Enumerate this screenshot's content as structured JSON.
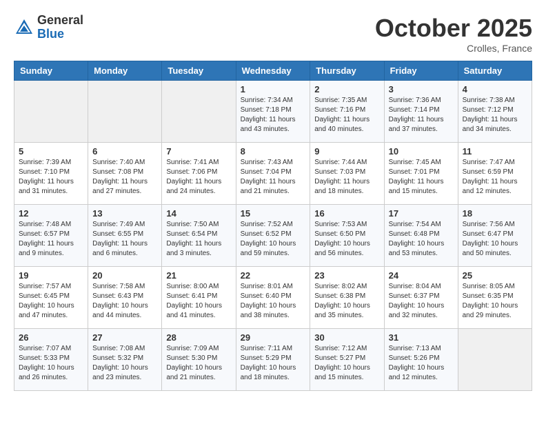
{
  "header": {
    "logo_line1": "General",
    "logo_line2": "Blue",
    "month_title": "October 2025",
    "location": "Crolles, France"
  },
  "days_of_week": [
    "Sunday",
    "Monday",
    "Tuesday",
    "Wednesday",
    "Thursday",
    "Friday",
    "Saturday"
  ],
  "weeks": [
    [
      {
        "day": "",
        "info": ""
      },
      {
        "day": "",
        "info": ""
      },
      {
        "day": "",
        "info": ""
      },
      {
        "day": "1",
        "info": "Sunrise: 7:34 AM\nSunset: 7:18 PM\nDaylight: 11 hours\nand 43 minutes."
      },
      {
        "day": "2",
        "info": "Sunrise: 7:35 AM\nSunset: 7:16 PM\nDaylight: 11 hours\nand 40 minutes."
      },
      {
        "day": "3",
        "info": "Sunrise: 7:36 AM\nSunset: 7:14 PM\nDaylight: 11 hours\nand 37 minutes."
      },
      {
        "day": "4",
        "info": "Sunrise: 7:38 AM\nSunset: 7:12 PM\nDaylight: 11 hours\nand 34 minutes."
      }
    ],
    [
      {
        "day": "5",
        "info": "Sunrise: 7:39 AM\nSunset: 7:10 PM\nDaylight: 11 hours\nand 31 minutes."
      },
      {
        "day": "6",
        "info": "Sunrise: 7:40 AM\nSunset: 7:08 PM\nDaylight: 11 hours\nand 27 minutes."
      },
      {
        "day": "7",
        "info": "Sunrise: 7:41 AM\nSunset: 7:06 PM\nDaylight: 11 hours\nand 24 minutes."
      },
      {
        "day": "8",
        "info": "Sunrise: 7:43 AM\nSunset: 7:04 PM\nDaylight: 11 hours\nand 21 minutes."
      },
      {
        "day": "9",
        "info": "Sunrise: 7:44 AM\nSunset: 7:03 PM\nDaylight: 11 hours\nand 18 minutes."
      },
      {
        "day": "10",
        "info": "Sunrise: 7:45 AM\nSunset: 7:01 PM\nDaylight: 11 hours\nand 15 minutes."
      },
      {
        "day": "11",
        "info": "Sunrise: 7:47 AM\nSunset: 6:59 PM\nDaylight: 11 hours\nand 12 minutes."
      }
    ],
    [
      {
        "day": "12",
        "info": "Sunrise: 7:48 AM\nSunset: 6:57 PM\nDaylight: 11 hours\nand 9 minutes."
      },
      {
        "day": "13",
        "info": "Sunrise: 7:49 AM\nSunset: 6:55 PM\nDaylight: 11 hours\nand 6 minutes."
      },
      {
        "day": "14",
        "info": "Sunrise: 7:50 AM\nSunset: 6:54 PM\nDaylight: 11 hours\nand 3 minutes."
      },
      {
        "day": "15",
        "info": "Sunrise: 7:52 AM\nSunset: 6:52 PM\nDaylight: 10 hours\nand 59 minutes."
      },
      {
        "day": "16",
        "info": "Sunrise: 7:53 AM\nSunset: 6:50 PM\nDaylight: 10 hours\nand 56 minutes."
      },
      {
        "day": "17",
        "info": "Sunrise: 7:54 AM\nSunset: 6:48 PM\nDaylight: 10 hours\nand 53 minutes."
      },
      {
        "day": "18",
        "info": "Sunrise: 7:56 AM\nSunset: 6:47 PM\nDaylight: 10 hours\nand 50 minutes."
      }
    ],
    [
      {
        "day": "19",
        "info": "Sunrise: 7:57 AM\nSunset: 6:45 PM\nDaylight: 10 hours\nand 47 minutes."
      },
      {
        "day": "20",
        "info": "Sunrise: 7:58 AM\nSunset: 6:43 PM\nDaylight: 10 hours\nand 44 minutes."
      },
      {
        "day": "21",
        "info": "Sunrise: 8:00 AM\nSunset: 6:41 PM\nDaylight: 10 hours\nand 41 minutes."
      },
      {
        "day": "22",
        "info": "Sunrise: 8:01 AM\nSunset: 6:40 PM\nDaylight: 10 hours\nand 38 minutes."
      },
      {
        "day": "23",
        "info": "Sunrise: 8:02 AM\nSunset: 6:38 PM\nDaylight: 10 hours\nand 35 minutes."
      },
      {
        "day": "24",
        "info": "Sunrise: 8:04 AM\nSunset: 6:37 PM\nDaylight: 10 hours\nand 32 minutes."
      },
      {
        "day": "25",
        "info": "Sunrise: 8:05 AM\nSunset: 6:35 PM\nDaylight: 10 hours\nand 29 minutes."
      }
    ],
    [
      {
        "day": "26",
        "info": "Sunrise: 7:07 AM\nSunset: 5:33 PM\nDaylight: 10 hours\nand 26 minutes."
      },
      {
        "day": "27",
        "info": "Sunrise: 7:08 AM\nSunset: 5:32 PM\nDaylight: 10 hours\nand 23 minutes."
      },
      {
        "day": "28",
        "info": "Sunrise: 7:09 AM\nSunset: 5:30 PM\nDaylight: 10 hours\nand 21 minutes."
      },
      {
        "day": "29",
        "info": "Sunrise: 7:11 AM\nSunset: 5:29 PM\nDaylight: 10 hours\nand 18 minutes."
      },
      {
        "day": "30",
        "info": "Sunrise: 7:12 AM\nSunset: 5:27 PM\nDaylight: 10 hours\nand 15 minutes."
      },
      {
        "day": "31",
        "info": "Sunrise: 7:13 AM\nSunset: 5:26 PM\nDaylight: 10 hours\nand 12 minutes."
      },
      {
        "day": "",
        "info": ""
      }
    ]
  ]
}
